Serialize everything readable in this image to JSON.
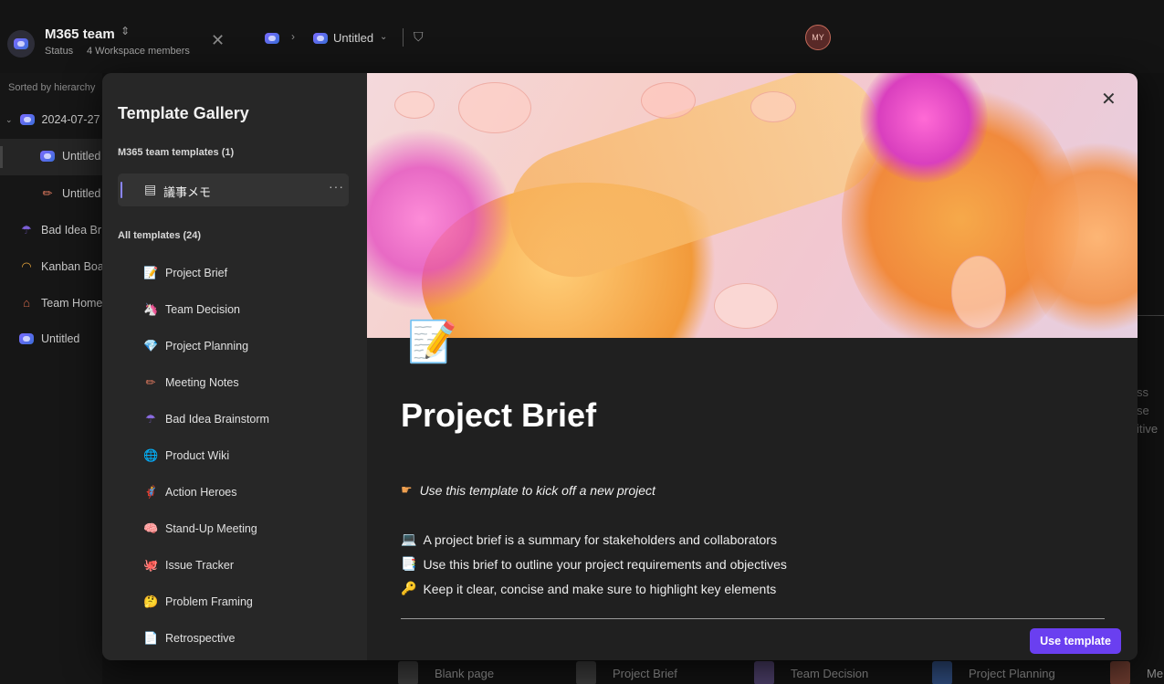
{
  "workspace": {
    "name": "M365 team",
    "status": "Status",
    "members": "4 Workspace members"
  },
  "breadcrumb": {
    "page": "Untitled"
  },
  "user": {
    "initials": "MY"
  },
  "sidebar": {
    "sort_label": "Sorted by hierarchy",
    "items": [
      {
        "icon": "loop-page-icon",
        "label": "2024-07-27"
      },
      {
        "icon": "loop-page-icon",
        "label": "Untitled"
      },
      {
        "icon": "pencil-icon",
        "label": "Untitled"
      },
      {
        "icon": "umbrella-icon",
        "label": "Bad Idea Br"
      },
      {
        "icon": "rainbow-icon",
        "label": "Kanban Boa"
      },
      {
        "icon": "house-icon",
        "label": "Team Home"
      },
      {
        "icon": "loop-page-icon",
        "label": "Untitled"
      }
    ]
  },
  "gallery": {
    "title": "Template Gallery",
    "team_section": "M365 team templates (1)",
    "team_items": [
      {
        "icon": "memo-icon",
        "label": "議事メモ",
        "more": "···"
      }
    ],
    "all_section": "All templates (24)",
    "templates": [
      {
        "icon": "memo-pencil-icon",
        "glyph": "📝",
        "label": "Project Brief"
      },
      {
        "icon": "unicorn-icon",
        "glyph": "🦄",
        "label": "Team Decision"
      },
      {
        "icon": "gem-icon",
        "glyph": "💎",
        "label": "Project Planning"
      },
      {
        "icon": "pencil-icon",
        "glyph": "✏",
        "label": "Meeting Notes"
      },
      {
        "icon": "umbrella-icon",
        "glyph": "☂",
        "label": "Bad Idea Brainstorm"
      },
      {
        "icon": "globe-icon",
        "glyph": "🌐",
        "label": "Product Wiki"
      },
      {
        "icon": "superhero-icon",
        "glyph": "🦸",
        "label": "Action Heroes"
      },
      {
        "icon": "brain-icon",
        "glyph": "🧠",
        "label": "Stand-Up Meeting"
      },
      {
        "icon": "octopus-icon",
        "glyph": "🐙",
        "label": "Issue Tracker"
      },
      {
        "icon": "thinking-face-icon",
        "glyph": "🤔",
        "label": "Problem Framing"
      },
      {
        "icon": "page-icon",
        "glyph": "📄",
        "label": "Retrospective"
      }
    ]
  },
  "preview": {
    "title": "Project Brief",
    "tagline_icon": "pointing-hand-icon",
    "tagline": "Use this template to kick off a new project",
    "bullets": [
      {
        "icon": "laptop-icon",
        "glyph": "💻",
        "text": "A project brief is a summary for stakeholders and collaborators"
      },
      {
        "icon": "memo-icon",
        "glyph": "📑",
        "text": "Use this brief to outline your project requirements and objectives"
      },
      {
        "icon": "key-icon",
        "glyph": "🔑",
        "text": "Keep it clear, concise and make sure to highlight key elements"
      }
    ],
    "use_button": "Use template"
  },
  "bottom_strip": [
    "Blank page",
    "Project Brief",
    "Team Decision",
    "Project Planning",
    "Me"
  ],
  "right_fragment": [
    "ss se",
    "itive"
  ],
  "colors": {
    "accent": "#6a3ff0",
    "selection_bar": "#8b85ff",
    "background": "#121212"
  }
}
